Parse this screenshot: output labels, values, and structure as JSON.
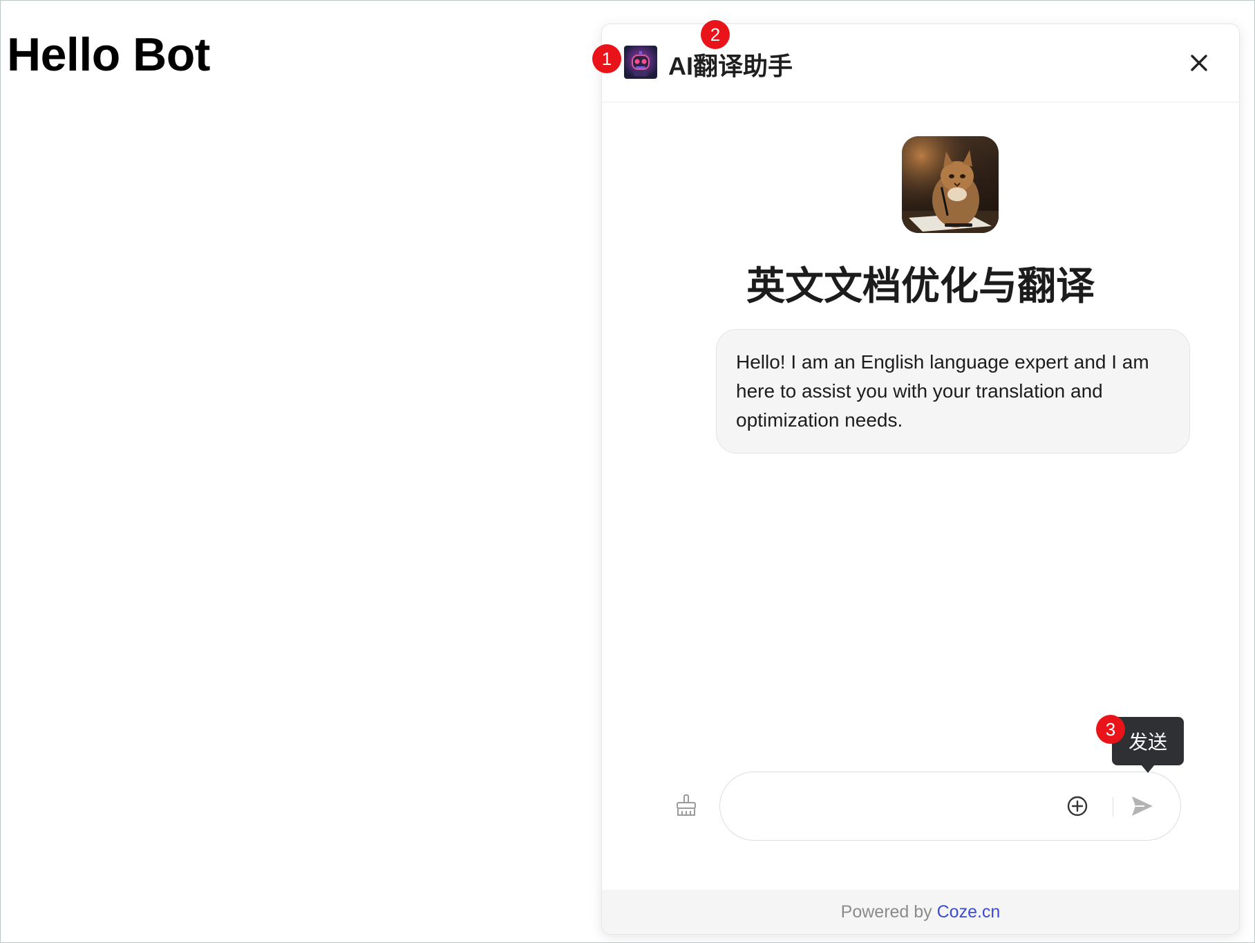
{
  "page": {
    "title": "Hello Bot"
  },
  "chat": {
    "header_title": "AI翻译助手",
    "close_label": "✕",
    "bot_name": "英文文档优化与翻译",
    "greeting": "Hello! I am an English language expert and I am here to assist you with your translation and optimization needs.",
    "input": {
      "value": "",
      "placeholder": ""
    },
    "tooltip": "发送",
    "footer": {
      "prefix": "Powered by ",
      "link": "Coze.cn"
    }
  },
  "annotations": [
    "1",
    "2",
    "3"
  ],
  "colors": {
    "marker": "#e8141a",
    "tooltip_bg": "#2e3033",
    "footer_link": "#3c4bd1",
    "bubble_bg": "#f5f5f6"
  },
  "icons": [
    "close-icon",
    "brush-icon",
    "add-circle-icon",
    "send-icon"
  ]
}
